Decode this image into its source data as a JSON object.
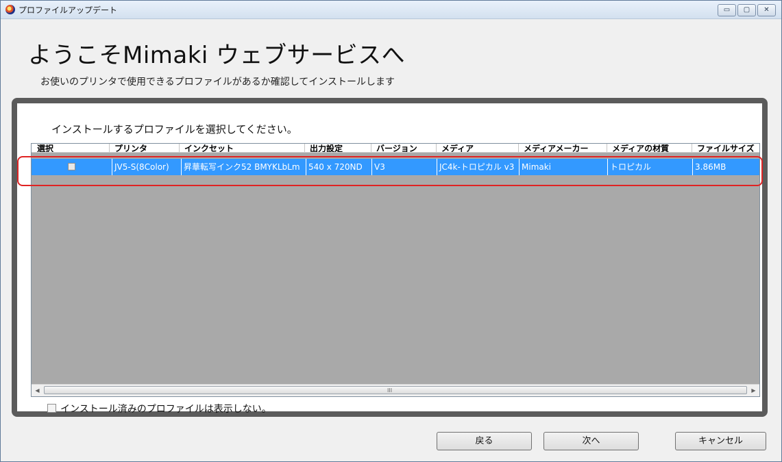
{
  "window": {
    "title": "プロファイルアップデート",
    "buttons": {
      "minimize": "▭",
      "maximize": "▢",
      "close": "✕"
    }
  },
  "heading": "ようこそMimaki ウェブサービスへ",
  "subtitle": "お使いのプリンタで使用できるプロファイルがあるか確認してインストールします",
  "instruction": "インストールするプロファイルを選択してください。",
  "grid": {
    "columns": [
      "選択",
      "プリンタ",
      "インクセット",
      "出力設定",
      "バージョン",
      "メディア",
      "メディアメーカー",
      "メディアの材質",
      "ファイルサイズ"
    ],
    "rows": [
      {
        "selected": false,
        "cells": [
          "",
          "JV5-S(8Color)",
          "昇華転写インク52 BMYKLbLm",
          "540 x 720ND",
          "V3",
          "JC4k-トロピカル v3",
          "Mimaki",
          "トロピカル",
          "3.86MB"
        ]
      }
    ],
    "scroll_grip": "III"
  },
  "hide_installed": {
    "checked": false,
    "label": "インストール済みのプロファイルは表示しない。"
  },
  "buttons": {
    "back": "戻る",
    "next": "次へ",
    "cancel": "キャンセル"
  },
  "colors": {
    "selection": "#3399ff",
    "highlight": "#e02323",
    "frame": "#5b5b5b"
  }
}
